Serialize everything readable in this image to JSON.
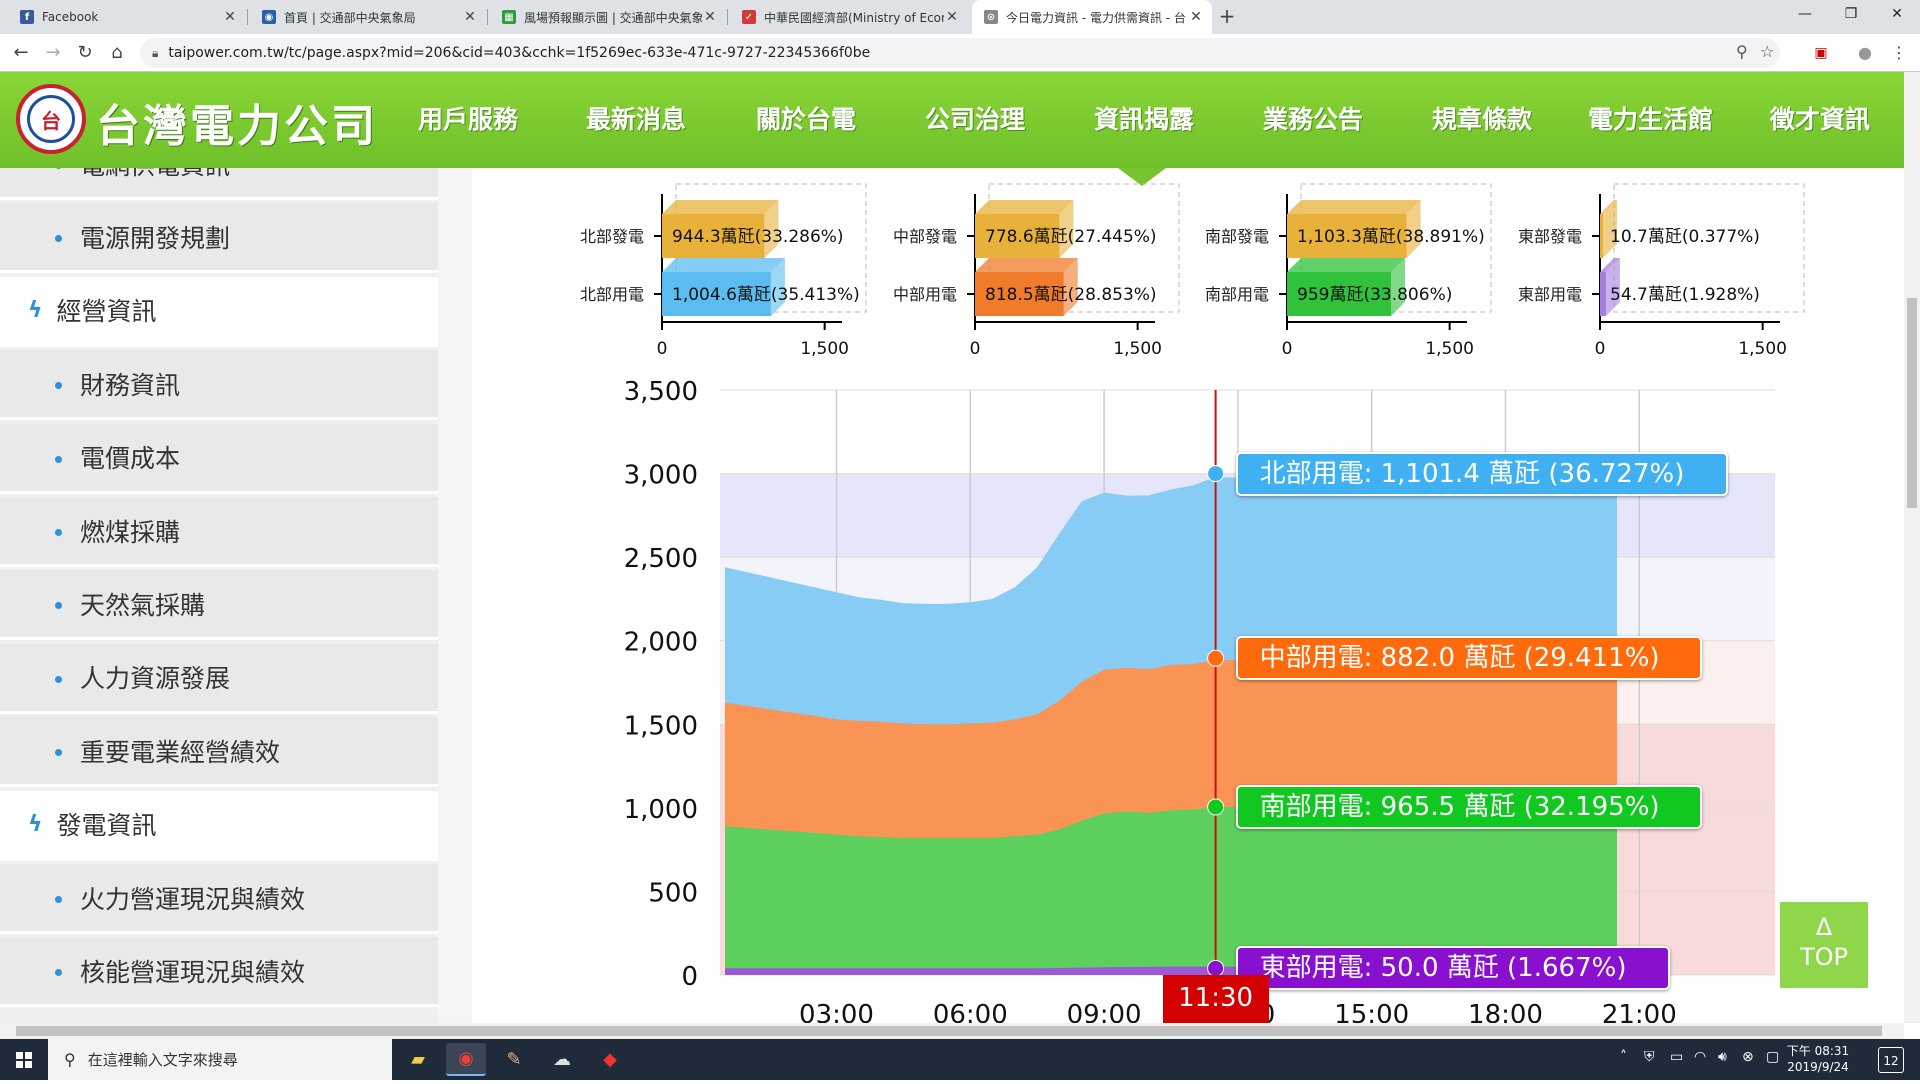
{
  "browser": {
    "tabs": [
      {
        "title": "Facebook",
        "icon_color": "#3b5998",
        "icon_glyph": "f",
        "active": false
      },
      {
        "title": "首頁 | 交通部中央氣象局",
        "icon_color": "#2b5fa8",
        "icon_glyph": "◉",
        "active": false
      },
      {
        "title": "風場預報顯示圖 | 交通部中央氣象",
        "icon_color": "#2f9a3f",
        "icon_glyph": "▦",
        "active": false
      },
      {
        "title": "中華民國經濟部(Ministry of Econ",
        "icon_color": "#d23b3b",
        "icon_glyph": "✓",
        "active": false
      },
      {
        "title": "今日電力資訊 - 電力供需資訊 - 台",
        "icon_color": "#888888",
        "icon_glyph": "⊙",
        "active": true
      }
    ],
    "new_tab_label": "+",
    "url": "taipower.com.tw/tc/page.aspx?mid=206&cid=403&cchk=1f5269ec-633e-471c-9727-22345366f0be"
  },
  "site": {
    "logo_text": "台灣電力公司",
    "logo_mark": "台",
    "nav": [
      "用戶服務",
      "最新消息",
      "關於台電",
      "公司治理",
      "資訊揭露",
      "業務公告",
      "規章條款",
      "電力生活館",
      "徵才資訊"
    ]
  },
  "sidebar": {
    "items": [
      {
        "label": "電網供電資訊",
        "kind": "sub"
      },
      {
        "label": "電源開發規劃",
        "kind": "sub"
      },
      {
        "label": "經營資訊",
        "kind": "cat"
      },
      {
        "label": "財務資訊",
        "kind": "sub"
      },
      {
        "label": "電價成本",
        "kind": "sub"
      },
      {
        "label": "燃煤採購",
        "kind": "sub"
      },
      {
        "label": "天然氣採購",
        "kind": "sub"
      },
      {
        "label": "人力資源發展",
        "kind": "sub"
      },
      {
        "label": "重要電業經營績效",
        "kind": "sub"
      },
      {
        "label": "發電資訊",
        "kind": "cat"
      },
      {
        "label": "火力營運現況與績效",
        "kind": "sub"
      },
      {
        "label": "核能營運現況與績效",
        "kind": "sub"
      }
    ]
  },
  "chart_data": [
    {
      "type": "bar",
      "region": "北部",
      "categories": [
        "北部發電",
        "北部用電"
      ],
      "values": [
        944.3,
        1004.6
      ],
      "labels": [
        "944.3萬瓩(33.286%)",
        "1,004.6萬瓩(35.413%)"
      ],
      "colors": [
        "#e8b13a",
        "#5bbcf0"
      ],
      "xlim": [
        0,
        2000
      ],
      "ticks": [
        "0",
        "1,500"
      ]
    },
    {
      "type": "bar",
      "region": "中部",
      "categories": [
        "中部發電",
        "中部用電"
      ],
      "values": [
        778.6,
        818.5
      ],
      "labels": [
        "778.6萬瓩(27.445%)",
        "818.5萬瓩(28.853%)"
      ],
      "colors": [
        "#e8b13a",
        "#f07b2a"
      ],
      "xlim": [
        0,
        2000
      ],
      "ticks": [
        "0",
        "1,500"
      ]
    },
    {
      "type": "bar",
      "region": "南部",
      "categories": [
        "南部發電",
        "南部用電"
      ],
      "values": [
        1103.3,
        959
      ],
      "labels": [
        "1,103.3萬瓩(38.891%)",
        "959萬瓩(33.806%)"
      ],
      "colors": [
        "#e8b13a",
        "#2fc23a"
      ],
      "xlim": [
        0,
        2000
      ],
      "ticks": [
        "0",
        "1,500"
      ]
    },
    {
      "type": "bar",
      "region": "東部",
      "categories": [
        "東部發電",
        "東部用電"
      ],
      "values": [
        10.7,
        54.7
      ],
      "labels": [
        "10.7萬瓩(0.377%)",
        "54.7萬瓩(1.928%)"
      ],
      "colors": [
        "#e8b13a",
        "#a77de0"
      ],
      "xlim": [
        0,
        2000
      ],
      "ticks": [
        "0",
        "1,500"
      ]
    },
    {
      "type": "area",
      "stacked": true,
      "x_hours": [
        0.5,
        1,
        1.5,
        2,
        2.5,
        3,
        3.5,
        4,
        4.5,
        5,
        5.5,
        6,
        6.5,
        7,
        7.5,
        8,
        8.5,
        9,
        9.5,
        10,
        10.5,
        11,
        11.5,
        12,
        12.5,
        13,
        13.5,
        14,
        14.5,
        15,
        15.5,
        16,
        16.5,
        17,
        17.5,
        18,
        18.5,
        19,
        19.5,
        20,
        20.5
      ],
      "x_ticks": [
        "03:00",
        "06:00",
        "09:00",
        "12:00",
        "15:00",
        "18:00",
        "21:00"
      ],
      "y_ticks": [
        "0",
        "500",
        "1,000",
        "1,500",
        "2,000",
        "2,500",
        "3,000",
        "3,500"
      ],
      "ylim": [
        0,
        3500
      ],
      "series": [
        {
          "name": "東部用電",
          "color": "#9b59d8",
          "values": [
            40,
            40,
            40,
            40,
            40,
            40,
            40,
            40,
            40,
            40,
            40,
            40,
            40,
            40,
            40,
            42,
            44,
            46,
            48,
            49,
            50,
            50,
            50,
            50,
            50,
            50,
            50,
            50,
            50,
            50,
            50,
            50,
            50,
            50,
            50,
            50,
            50,
            50,
            50,
            50,
            50
          ]
        },
        {
          "name": "南部用電",
          "color": "#5ccf5c",
          "values": [
            850,
            840,
            830,
            820,
            810,
            800,
            790,
            785,
            780,
            780,
            780,
            780,
            780,
            790,
            800,
            830,
            880,
            920,
            930,
            920,
            935,
            940,
            955,
            955,
            955,
            955,
            955,
            955,
            955,
            955,
            955,
            955,
            955,
            955,
            955,
            955,
            955,
            955,
            955,
            955,
            955
          ]
        },
        {
          "name": "中部用電",
          "color": "#fa9454",
          "values": [
            740,
            730,
            720,
            710,
            700,
            690,
            690,
            690,
            685,
            680,
            680,
            685,
            690,
            700,
            720,
            770,
            830,
            860,
            860,
            860,
            870,
            870,
            880,
            880,
            880,
            880,
            880,
            880,
            880,
            880,
            880,
            880,
            880,
            880,
            880,
            880,
            880,
            880,
            880,
            880,
            880
          ]
        },
        {
          "name": "北部用電",
          "color": "#87ccf5",
          "values": [
            810,
            800,
            790,
            780,
            770,
            760,
            740,
            730,
            720,
            720,
            720,
            725,
            740,
            790,
            880,
            1000,
            1080,
            1060,
            1030,
            1040,
            1050,
            1070,
            1095,
            1090,
            1090,
            1090,
            1090,
            1090,
            1090,
            1090,
            1090,
            1090,
            1090,
            1090,
            1090,
            1090,
            1090,
            1090,
            1090,
            1090,
            1090
          ]
        }
      ],
      "current_time": "11:30",
      "current_hour": 11.5,
      "callouts": [
        {
          "text": "北部用電: 1,101.4 萬瓩 (36.727%)",
          "value": 3000,
          "color": "#3fb1f2"
        },
        {
          "text": "中部用電: 882.0 萬瓩 (29.411%)",
          "value": 1895,
          "color": "#ff6a0d"
        },
        {
          "text": "南部用電: 965.5 萬瓩 (32.195%)",
          "value": 1005,
          "color": "#10c820"
        },
        {
          "text": "東部用電: 50.0 萬瓩 (1.667%)",
          "value": 40,
          "color": "#8a10d0"
        }
      ],
      "bands": [
        {
          "from": 2500,
          "to": 3000,
          "color": "#e6e6fa"
        },
        {
          "from": 2000,
          "to": 2500,
          "color": "#f3f3fb"
        },
        {
          "from": 1500,
          "to": 2000,
          "color": "#fcf0ee"
        },
        {
          "from": 0,
          "to": 1500,
          "color": "#f8dada"
        }
      ]
    }
  ],
  "top_button": {
    "arrow": "Δ",
    "label": "TOP"
  },
  "taskbar": {
    "search_placeholder": "在這裡輸入文字來搜尋",
    "time": "下午 08:31",
    "date": "2019/9/24",
    "notifications": "12"
  }
}
